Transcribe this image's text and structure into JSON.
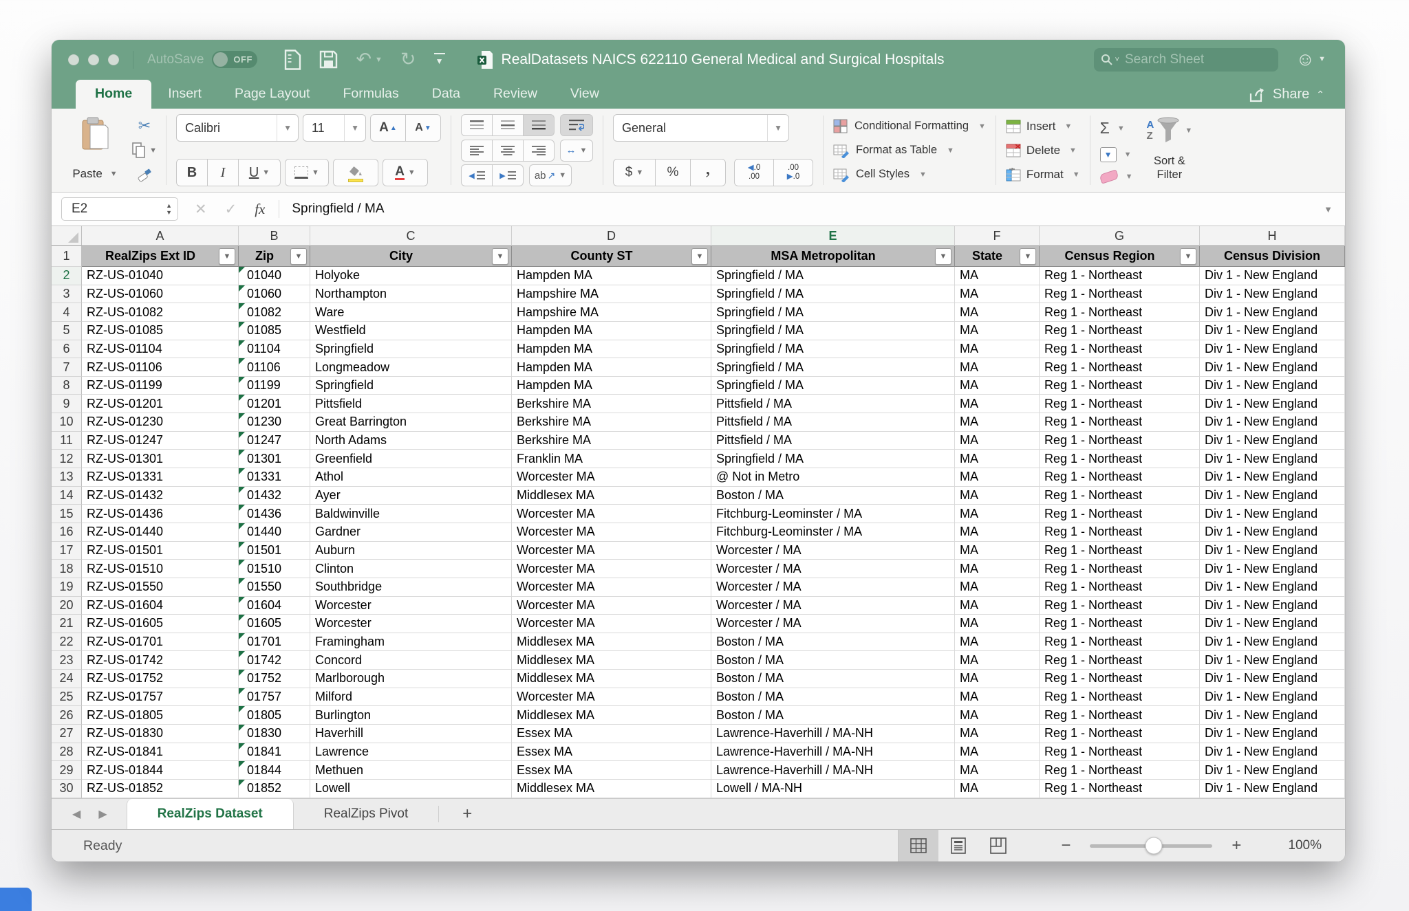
{
  "titlebar": {
    "autosave_label": "AutoSave",
    "autosave_state": "OFF",
    "title": "RealDatasets NAICS 622110 General Medical and Surgical Hospitals",
    "search_placeholder": "Search Sheet"
  },
  "ribbon_tabs": [
    {
      "label": "Home",
      "active": true
    },
    {
      "label": "Insert",
      "active": false
    },
    {
      "label": "Page Layout",
      "active": false
    },
    {
      "label": "Formulas",
      "active": false
    },
    {
      "label": "Data",
      "active": false
    },
    {
      "label": "Review",
      "active": false
    },
    {
      "label": "View",
      "active": false
    }
  ],
  "share_label": "Share",
  "ribbon": {
    "paste_label": "Paste",
    "font_name": "Calibri",
    "font_size": "11",
    "number_format": "General",
    "conditional_formatting_label": "Conditional Formatting",
    "format_as_table_label": "Format as Table",
    "cell_styles_label": "Cell Styles",
    "insert_label": "Insert",
    "delete_label": "Delete",
    "format_label": "Format",
    "sort_filter_line1": "Sort &",
    "sort_filter_line2": "Filter",
    "glyphs": {
      "bold": "B",
      "italic": "I",
      "underline": "U",
      "grow_font": "A",
      "shrink_font": "A",
      "font_color": "A",
      "dollar": "$",
      "percent": "%",
      "comma": ",",
      "sigma": "Σ",
      "orientation": "ab",
      "inc_dec_top": ".0",
      "inc_dec_bottom": ".00",
      "dec_dec_top": ".00",
      "dec_dec_bottom": ".0"
    }
  },
  "formula_bar": {
    "cell_ref": "E2",
    "value": "Springfield / MA"
  },
  "sheet": {
    "columns": [
      "A",
      "B",
      "C",
      "D",
      "E",
      "F",
      "G",
      "H"
    ],
    "selected_column": "E",
    "selected_row": 2,
    "header_row_number": "1",
    "headers": [
      "RealZips Ext ID",
      "Zip",
      "City",
      "County ST",
      "MSA Metropolitan",
      "State",
      "Census Region",
      "Census Division"
    ],
    "filter_column_count": 7,
    "rows": [
      {
        "row": 2,
        "cells": [
          "RZ-US-01040",
          "01040",
          "Holyoke",
          "Hampden MA",
          "Springfield / MA",
          "MA",
          "Reg 1 - Northeast",
          "Div 1 - New England"
        ]
      },
      {
        "row": 3,
        "cells": [
          "RZ-US-01060",
          "01060",
          "Northampton",
          "Hampshire MA",
          "Springfield / MA",
          "MA",
          "Reg 1 - Northeast",
          "Div 1 - New England"
        ]
      },
      {
        "row": 4,
        "cells": [
          "RZ-US-01082",
          "01082",
          "Ware",
          "Hampshire MA",
          "Springfield / MA",
          "MA",
          "Reg 1 - Northeast",
          "Div 1 - New England"
        ]
      },
      {
        "row": 5,
        "cells": [
          "RZ-US-01085",
          "01085",
          "Westfield",
          "Hampden MA",
          "Springfield / MA",
          "MA",
          "Reg 1 - Northeast",
          "Div 1 - New England"
        ]
      },
      {
        "row": 6,
        "cells": [
          "RZ-US-01104",
          "01104",
          "Springfield",
          "Hampden MA",
          "Springfield / MA",
          "MA",
          "Reg 1 - Northeast",
          "Div 1 - New England"
        ]
      },
      {
        "row": 7,
        "cells": [
          "RZ-US-01106",
          "01106",
          "Longmeadow",
          "Hampden MA",
          "Springfield / MA",
          "MA",
          "Reg 1 - Northeast",
          "Div 1 - New England"
        ]
      },
      {
        "row": 8,
        "cells": [
          "RZ-US-01199",
          "01199",
          "Springfield",
          "Hampden MA",
          "Springfield / MA",
          "MA",
          "Reg 1 - Northeast",
          "Div 1 - New England"
        ]
      },
      {
        "row": 9,
        "cells": [
          "RZ-US-01201",
          "01201",
          "Pittsfield",
          "Berkshire MA",
          "Pittsfield / MA",
          "MA",
          "Reg 1 - Northeast",
          "Div 1 - New England"
        ]
      },
      {
        "row": 10,
        "cells": [
          "RZ-US-01230",
          "01230",
          "Great Barrington",
          "Berkshire MA",
          "Pittsfield / MA",
          "MA",
          "Reg 1 - Northeast",
          "Div 1 - New England"
        ]
      },
      {
        "row": 11,
        "cells": [
          "RZ-US-01247",
          "01247",
          "North Adams",
          "Berkshire MA",
          "Pittsfield / MA",
          "MA",
          "Reg 1 - Northeast",
          "Div 1 - New England"
        ]
      },
      {
        "row": 12,
        "cells": [
          "RZ-US-01301",
          "01301",
          "Greenfield",
          "Franklin MA",
          "Springfield / MA",
          "MA",
          "Reg 1 - Northeast",
          "Div 1 - New England"
        ]
      },
      {
        "row": 13,
        "cells": [
          "RZ-US-01331",
          "01331",
          "Athol",
          "Worcester MA",
          "@ Not in Metro",
          "MA",
          "Reg 1 - Northeast",
          "Div 1 - New England"
        ]
      },
      {
        "row": 14,
        "cells": [
          "RZ-US-01432",
          "01432",
          "Ayer",
          "Middlesex MA",
          "Boston / MA",
          "MA",
          "Reg 1 - Northeast",
          "Div 1 - New England"
        ]
      },
      {
        "row": 15,
        "cells": [
          "RZ-US-01436",
          "01436",
          "Baldwinville",
          "Worcester MA",
          "Fitchburg-Leominster / MA",
          "MA",
          "Reg 1 - Northeast",
          "Div 1 - New England"
        ]
      },
      {
        "row": 16,
        "cells": [
          "RZ-US-01440",
          "01440",
          "Gardner",
          "Worcester MA",
          "Fitchburg-Leominster / MA",
          "MA",
          "Reg 1 - Northeast",
          "Div 1 - New England"
        ]
      },
      {
        "row": 17,
        "cells": [
          "RZ-US-01501",
          "01501",
          "Auburn",
          "Worcester MA",
          "Worcester / MA",
          "MA",
          "Reg 1 - Northeast",
          "Div 1 - New England"
        ]
      },
      {
        "row": 18,
        "cells": [
          "RZ-US-01510",
          "01510",
          "Clinton",
          "Worcester MA",
          "Worcester / MA",
          "MA",
          "Reg 1 - Northeast",
          "Div 1 - New England"
        ]
      },
      {
        "row": 19,
        "cells": [
          "RZ-US-01550",
          "01550",
          "Southbridge",
          "Worcester MA",
          "Worcester / MA",
          "MA",
          "Reg 1 - Northeast",
          "Div 1 - New England"
        ]
      },
      {
        "row": 20,
        "cells": [
          "RZ-US-01604",
          "01604",
          "Worcester",
          "Worcester MA",
          "Worcester / MA",
          "MA",
          "Reg 1 - Northeast",
          "Div 1 - New England"
        ]
      },
      {
        "row": 21,
        "cells": [
          "RZ-US-01605",
          "01605",
          "Worcester",
          "Worcester MA",
          "Worcester / MA",
          "MA",
          "Reg 1 - Northeast",
          "Div 1 - New England"
        ]
      },
      {
        "row": 22,
        "cells": [
          "RZ-US-01701",
          "01701",
          "Framingham",
          "Middlesex MA",
          "Boston / MA",
          "MA",
          "Reg 1 - Northeast",
          "Div 1 - New England"
        ]
      },
      {
        "row": 23,
        "cells": [
          "RZ-US-01742",
          "01742",
          "Concord",
          "Middlesex MA",
          "Boston / MA",
          "MA",
          "Reg 1 - Northeast",
          "Div 1 - New England"
        ]
      },
      {
        "row": 24,
        "cells": [
          "RZ-US-01752",
          "01752",
          "Marlborough",
          "Middlesex MA",
          "Boston / MA",
          "MA",
          "Reg 1 - Northeast",
          "Div 1 - New England"
        ]
      },
      {
        "row": 25,
        "cells": [
          "RZ-US-01757",
          "01757",
          "Milford",
          "Worcester MA",
          "Boston / MA",
          "MA",
          "Reg 1 - Northeast",
          "Div 1 - New England"
        ]
      },
      {
        "row": 26,
        "cells": [
          "RZ-US-01805",
          "01805",
          "Burlington",
          "Middlesex MA",
          "Boston / MA",
          "MA",
          "Reg 1 - Northeast",
          "Div 1 - New England"
        ]
      },
      {
        "row": 27,
        "cells": [
          "RZ-US-01830",
          "01830",
          "Haverhill",
          "Essex MA",
          "Lawrence-Haverhill / MA-NH",
          "MA",
          "Reg 1 - Northeast",
          "Div 1 - New England"
        ]
      },
      {
        "row": 28,
        "cells": [
          "RZ-US-01841",
          "01841",
          "Lawrence",
          "Essex MA",
          "Lawrence-Haverhill / MA-NH",
          "MA",
          "Reg 1 - Northeast",
          "Div 1 - New England"
        ]
      },
      {
        "row": 29,
        "cells": [
          "RZ-US-01844",
          "01844",
          "Methuen",
          "Essex MA",
          "Lawrence-Haverhill / MA-NH",
          "MA",
          "Reg 1 - Northeast",
          "Div 1 - New England"
        ]
      },
      {
        "row": 30,
        "cells": [
          "RZ-US-01852",
          "01852",
          "Lowell",
          "Middlesex MA",
          "Lowell / MA-NH",
          "MA",
          "Reg 1 - Northeast",
          "Div 1 - New England"
        ]
      }
    ]
  },
  "sheet_tabs": {
    "tabs": [
      {
        "label": "RealZips Dataset",
        "active": true
      },
      {
        "label": "RealZips Pivot",
        "active": false
      }
    ],
    "add_label": "+"
  },
  "status_bar": {
    "status": "Ready",
    "zoom": "100%"
  },
  "colors": {
    "titlebar_green": "#6FA287",
    "excel_green": "#1E7145",
    "header_gray": "#BFBFBF",
    "fill_yellow": "#FCE34D",
    "font_color_red": "#E53E3E",
    "error_triangle_green": "#1E7145"
  }
}
